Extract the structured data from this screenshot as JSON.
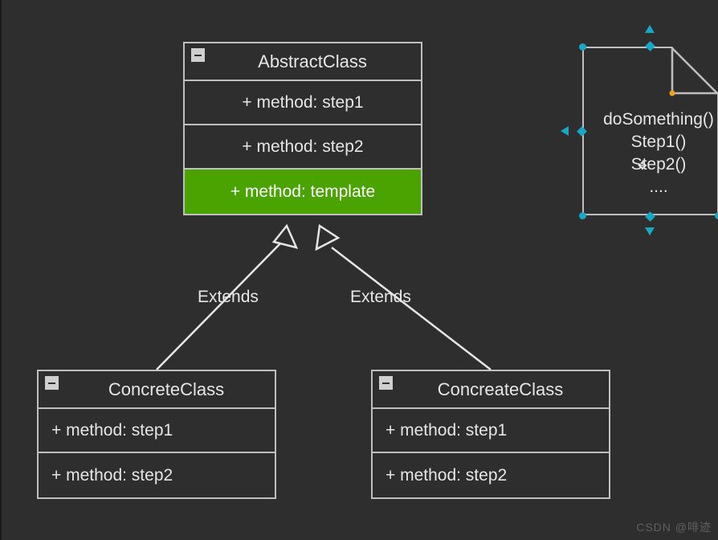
{
  "abstract": {
    "title": "AbstractClass",
    "rows": [
      "+ method: step1",
      "+ method: step2",
      "+ method: template"
    ]
  },
  "concrete1": {
    "title": "ConcreteClass",
    "rows": [
      "+ method: step1",
      "+ method: step2"
    ]
  },
  "concrete2": {
    "title": "ConcreateClass",
    "rows": [
      "+ method: step1",
      "+ method: step2"
    ]
  },
  "edges": {
    "left": "Extends",
    "right": "Extends"
  },
  "note": {
    "line1": "doSomething()",
    "line2": "Step1()",
    "line3": "Step2()",
    "line4": "...."
  },
  "watermark": "CSDN @啡迹"
}
